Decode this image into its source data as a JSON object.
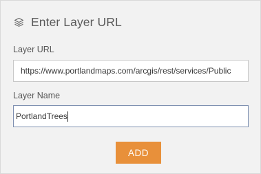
{
  "header": {
    "icon": "layers-icon",
    "title": "Enter Layer URL"
  },
  "form": {
    "layer_url": {
      "label": "Layer URL",
      "value": "https://www.portlandmaps.com/arcgis/rest/services/Public"
    },
    "layer_name": {
      "label": "Layer Name",
      "value": "PortlandTrees"
    },
    "add_label": "ADD"
  },
  "colors": {
    "panel_background": "#f2f2f2",
    "button_accent": "#e8903a",
    "focused_border": "#7d8fb0"
  }
}
